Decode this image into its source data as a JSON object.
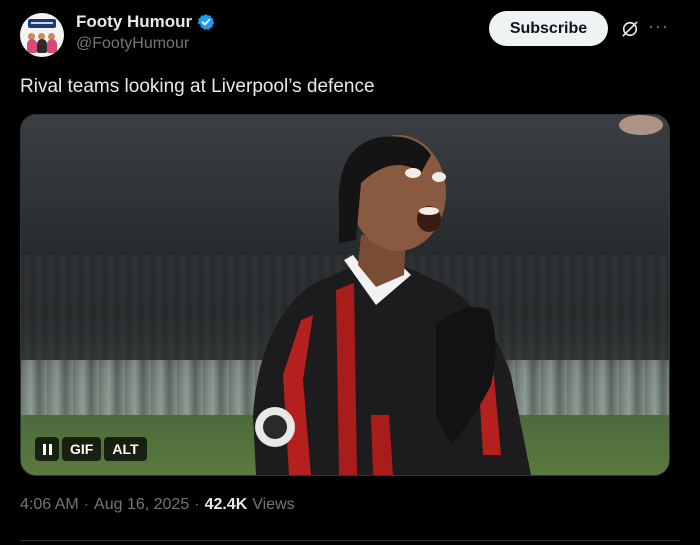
{
  "author": {
    "display_name": "Footy Humour",
    "handle": "@FootyHumour",
    "avatar_text": "FOOTY HUMOUR"
  },
  "actions": {
    "subscribe_label": "Subscribe",
    "grok_icon": "grok-icon",
    "more_icon": "more-icon"
  },
  "tweet": {
    "text": "Rival teams looking at Liverpool’s defence"
  },
  "media": {
    "type": "gif",
    "gif_label": "GIF",
    "alt_label": "ALT"
  },
  "meta": {
    "time": "4:06 AM",
    "sep1": "·",
    "date": "Aug 16, 2025",
    "sep2": "·",
    "views_count": "42.4K",
    "views_label": "Views"
  },
  "colors": {
    "background": "#000000",
    "verified": "#1d9bf0",
    "secondary_text": "#71767b"
  }
}
